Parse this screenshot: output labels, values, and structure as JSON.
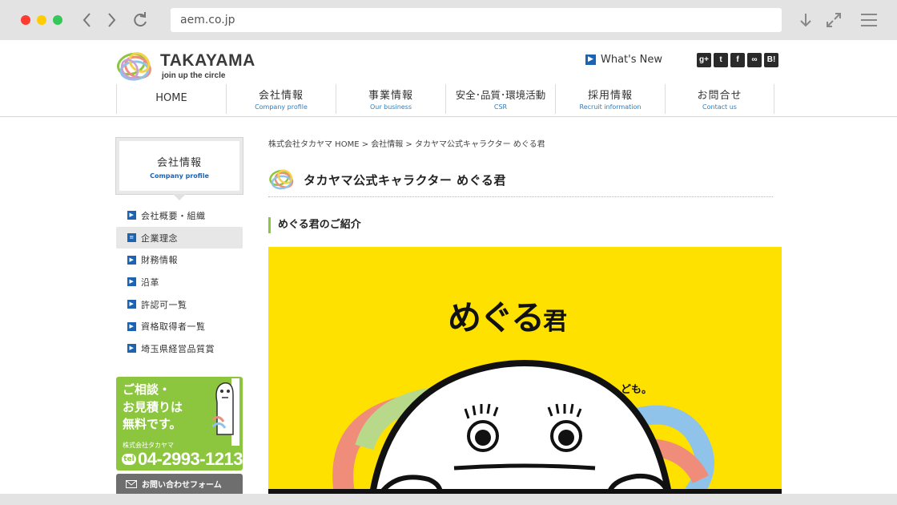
{
  "browser": {
    "url": "aem.co.jp"
  },
  "header": {
    "logo_name": "TAKAYAMA",
    "logo_tagline": "join up the circle",
    "whats_new": "What's New",
    "social": [
      "g+",
      "t",
      "f",
      "∞",
      "B!"
    ]
  },
  "gnav": [
    {
      "jp": "HOME",
      "en": ""
    },
    {
      "jp": "会社情報",
      "en": "Company profile"
    },
    {
      "jp": "事業情報",
      "en": "Our business"
    },
    {
      "jp": "安全･品質･環境活動",
      "en": "CSR"
    },
    {
      "jp": "採用情報",
      "en": "Recruit information"
    },
    {
      "jp": "お問合せ",
      "en": "Contact us"
    }
  ],
  "sidebar": {
    "title_jp": "会社情報",
    "title_en": "Company profile",
    "items": [
      {
        "label": "会社概要・組織"
      },
      {
        "label": "企業理念"
      },
      {
        "label": "財務情報"
      },
      {
        "label": "沿革"
      },
      {
        "label": "許認可一覧"
      },
      {
        "label": "資格取得者一覧"
      },
      {
        "label": "埼玉県経営品質賞"
      }
    ],
    "consult_line1": "ご相談・",
    "consult_line2": "お見積りは",
    "consult_line3": "無料です。",
    "consult_company": "株式会社タカヤマ",
    "consult_tel_label": "tel",
    "consult_tel": "04-2993-1213",
    "contact_form": "お問い合わせフォーム"
  },
  "main": {
    "breadcrumb": "株式会社タカヤマ HOME > 会社情報 > タカヤマ公式キャラクター めぐる君",
    "title": "タカヤマ公式キャラクター めぐる君",
    "subtitle": "めぐる君のご紹介",
    "hero_title": "めぐる",
    "hero_title_suffix": "君",
    "hero_speech": "ども。"
  },
  "colors": {
    "brand_blue": "#1b64b4",
    "brand_green": "#8cc63f",
    "hero_yellow": "#ffe100"
  }
}
